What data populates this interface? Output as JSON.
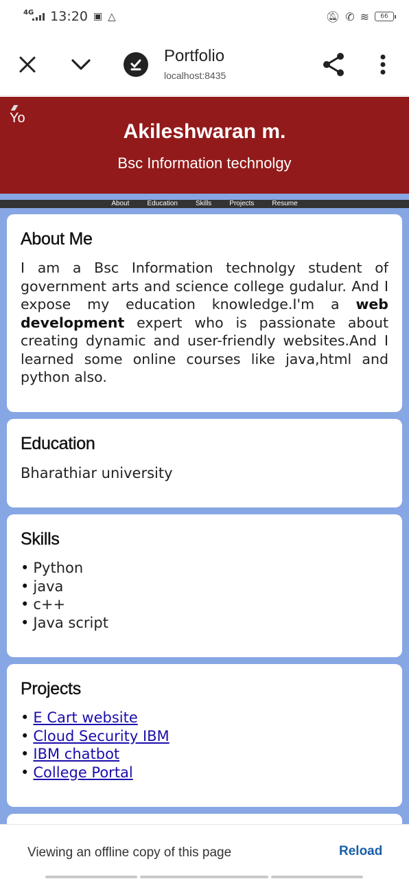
{
  "status": {
    "network": "4G",
    "time": "13:20",
    "battery": "66"
  },
  "browser": {
    "title": "Portfolio",
    "url": "localhost:8435"
  },
  "site": {
    "corner_text": "Yo",
    "name": "Akileshwaran m.",
    "subtitle": "Bsc Information technolgy",
    "nav": [
      "About",
      "Education",
      "Skills",
      "Projects",
      "Resume"
    ]
  },
  "about": {
    "heading": "About Me",
    "text_before": "I am a Bsc Information technolgy student of government arts and science college gudalur. And I expose my education knowledge.I'm a ",
    "text_bold": "web development",
    "text_after": " expert who is passionate about creating dynamic and user-friendly websites.And I learned some online courses like java,html and python also."
  },
  "education": {
    "heading": "Education",
    "text": "Bharathiar university"
  },
  "skills": {
    "heading": "Skills",
    "items": [
      "Python",
      "java",
      "c++",
      "Java script"
    ]
  },
  "projects": {
    "heading": "Projects",
    "items": [
      "E Cart website",
      "Cloud Security IBM",
      "IBM chatbot",
      "College Portal"
    ]
  },
  "offline": {
    "message": "Viewing an offline copy of this page",
    "reload_label": "Reload"
  }
}
